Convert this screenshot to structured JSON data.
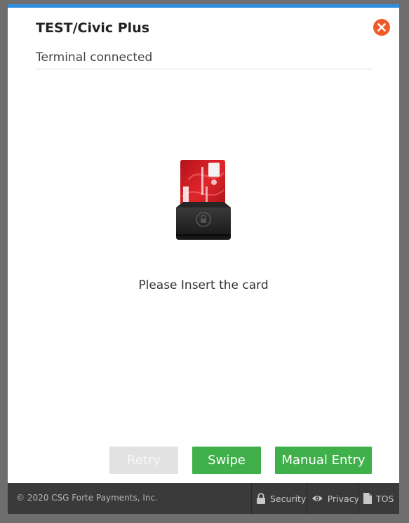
{
  "dialog": {
    "title": "TEST/Civic Plus",
    "status": "Terminal connected",
    "prompt": "Please Insert the card"
  },
  "buttons": {
    "retry": "Retry",
    "swipe": "Swipe",
    "manual_entry": "Manual Entry"
  },
  "footer": {
    "copyright": "© 2020 CSG Forte Payments, Inc.",
    "security": "Security",
    "privacy": "Privacy",
    "tos": "TOS"
  },
  "colors": {
    "accent_bar": "#2f8fdc",
    "close": "#f05a28",
    "primary_button": "#3fb04a",
    "disabled_button": "#e2e2e2",
    "footer": "#3a3a3a"
  },
  "icons": {
    "close": "close-icon",
    "card_reader": "card-insert-icon",
    "security": "lock-icon",
    "privacy": "eye-icon",
    "tos": "document-icon"
  }
}
